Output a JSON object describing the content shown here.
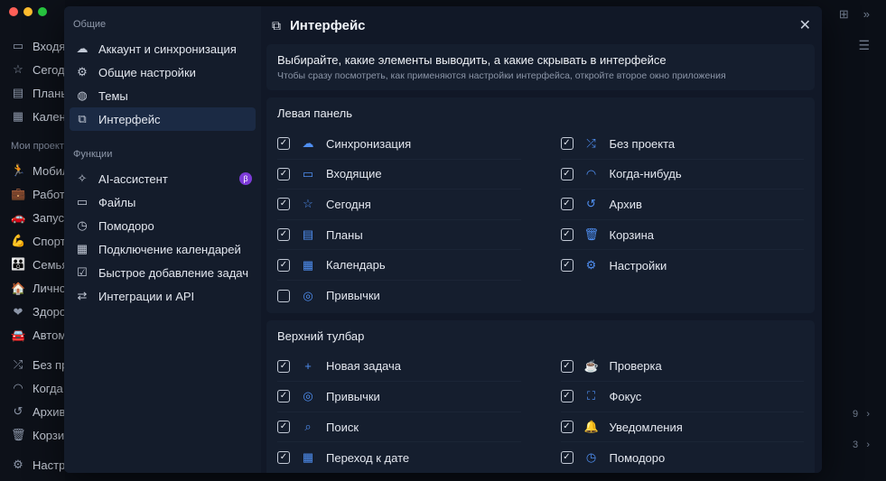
{
  "colors": {
    "accent": "#4f8ff2",
    "active_bg": "#1b2a44",
    "badge": "#7d3bd8"
  },
  "background": {
    "items_top": [
      {
        "label": "Входя",
        "icon": "inbox-icon"
      },
      {
        "label": "Сегод",
        "icon": "star-icon"
      },
      {
        "label": "Планы",
        "icon": "plans-icon"
      },
      {
        "label": "Кален",
        "icon": "calendar-icon"
      }
    ],
    "projects_label": "Мои проекты",
    "projects": [
      {
        "label": "Мобил",
        "icon": "runner-icon"
      },
      {
        "label": "Работа",
        "icon": "briefcase-icon"
      },
      {
        "label": "Запус",
        "icon": "car-icon"
      },
      {
        "label": "Спорт",
        "icon": "muscle-icon"
      },
      {
        "label": "Семья",
        "icon": "family-icon"
      },
      {
        "label": "Лично",
        "icon": "house-icon"
      },
      {
        "label": "Здоро",
        "icon": "heart-icon"
      },
      {
        "label": "Автом",
        "icon": "auto-icon"
      }
    ],
    "items_bottom": [
      {
        "label": "Без пр",
        "icon": "shuffle-icon"
      },
      {
        "label": "Когда",
        "icon": "rainbow-icon"
      },
      {
        "label": "Архив",
        "icon": "history-icon"
      },
      {
        "label": "Корзи",
        "icon": "trash-icon"
      },
      {
        "label": "Настр",
        "icon": "gear-icon"
      }
    ],
    "counts": [
      "9",
      "3"
    ]
  },
  "settings": {
    "sections": [
      {
        "label": "Общие",
        "items": [
          {
            "label": "Аккаунт и синхронизация",
            "icon": "cloud-icon"
          },
          {
            "label": "Общие настройки",
            "icon": "gear-icon"
          },
          {
            "label": "Темы",
            "icon": "palette-icon"
          },
          {
            "label": "Интерфейс",
            "icon": "interface-icon",
            "active": true
          }
        ]
      },
      {
        "label": "Функции",
        "items": [
          {
            "label": "AI-ассистент",
            "icon": "ai-icon",
            "badge": "β"
          },
          {
            "label": "Файлы",
            "icon": "folder-icon"
          },
          {
            "label": "Помодоро",
            "icon": "timer-icon"
          },
          {
            "label": "Подключение календарей",
            "icon": "calendar-icon"
          },
          {
            "label": "Быстрое добавление задач",
            "icon": "quick-add-icon"
          },
          {
            "label": "Интеграции и API",
            "icon": "arrows-icon"
          }
        ]
      }
    ]
  },
  "panel": {
    "title": "Интерфейс",
    "intro_title": "Выбирайте, какие элементы выводить, а какие скрывать в интерфейсе",
    "intro_sub": "Чтобы сразу посмотреть, как применяются настройки интерфейса, откройте второе окно приложения",
    "groups": [
      {
        "title": "Левая панель",
        "left": [
          {
            "label": "Синхронизация",
            "icon": "cloud-icon",
            "checked": true
          },
          {
            "label": "Входящие",
            "icon": "inbox-icon",
            "checked": true
          },
          {
            "label": "Сегодня",
            "icon": "star-icon",
            "checked": true
          },
          {
            "label": "Планы",
            "icon": "plans-icon",
            "checked": true
          },
          {
            "label": "Календарь",
            "icon": "calendar-icon",
            "checked": true
          },
          {
            "label": "Привычки",
            "icon": "habits-icon",
            "checked": false
          }
        ],
        "right": [
          {
            "label": "Без проекта",
            "icon": "shuffle-icon",
            "checked": true
          },
          {
            "label": "Когда-нибудь",
            "icon": "rainbow-icon",
            "checked": true
          },
          {
            "label": "Архив",
            "icon": "history-icon",
            "checked": true
          },
          {
            "label": "Корзина",
            "icon": "trash-icon",
            "checked": true
          },
          {
            "label": "Настройки",
            "icon": "gear-icon",
            "checked": true
          }
        ]
      },
      {
        "title": "Верхний тулбар",
        "left": [
          {
            "label": "Новая задача",
            "icon": "plus-icon",
            "checked": true
          },
          {
            "label": "Привычки",
            "icon": "habits-icon",
            "checked": true
          },
          {
            "label": "Поиск",
            "icon": "search-icon",
            "checked": true
          },
          {
            "label": "Переход к дате",
            "icon": "calendar-icon",
            "checked": true
          }
        ],
        "right": [
          {
            "label": "Проверка",
            "icon": "review-icon",
            "checked": true
          },
          {
            "label": "Фокус",
            "icon": "focus-icon",
            "checked": true
          },
          {
            "label": "Уведомления",
            "icon": "bell-icon",
            "checked": true
          },
          {
            "label": "Помодоро",
            "icon": "timer-icon",
            "checked": true
          }
        ]
      }
    ]
  }
}
